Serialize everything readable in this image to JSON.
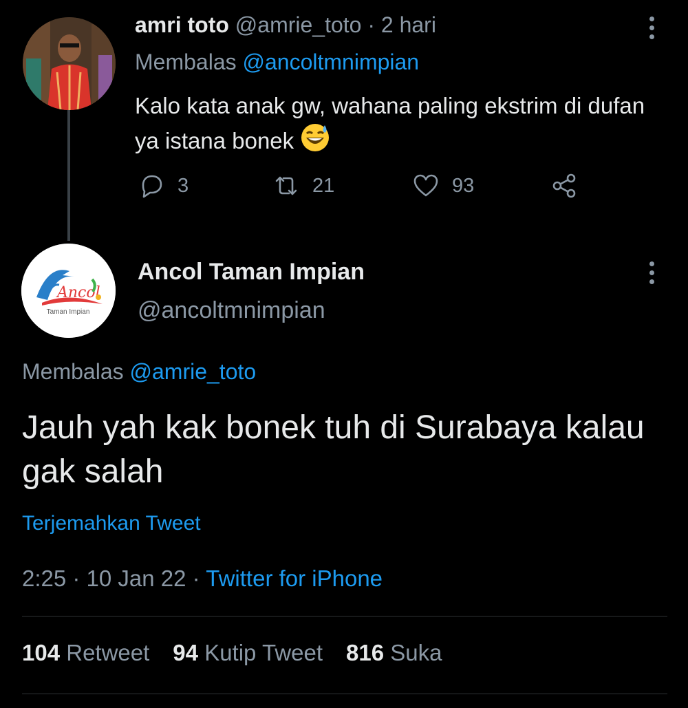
{
  "parent_tweet": {
    "name": "amri toto",
    "handle": "@amrie_toto",
    "time": "· 2 hari",
    "reply_prefix": "Membalas",
    "reply_to": "@ancoltmnimpian",
    "text": "Kalo kata anak gw, wahana paling ekstrim di dufan ya istana bonek",
    "emoji": "grinning-sweat-emoji",
    "replies": "3",
    "retweets": "21",
    "likes": "93"
  },
  "main_tweet": {
    "name": "Ancol Taman Impian",
    "handle": "@ancoltmnimpian",
    "logo_text": "Ancol",
    "logo_sub": "Taman Impian",
    "reply_prefix": "Membalas",
    "reply_to": "@amrie_toto",
    "text": "Jauh yah kak bonek tuh di Surabaya kalau gak salah",
    "translate": "Terjemahkan Tweet",
    "time": "2:25 · 10 Jan 22 ·",
    "source": "Twitter for iPhone",
    "retweet_count": "104",
    "retweet_label": "Retweet",
    "quote_count": "94",
    "quote_label": "Kutip Tweet",
    "like_count": "816",
    "like_label": "Suka"
  },
  "colors": {
    "background": "#000000",
    "text": "#e7e9ea",
    "muted": "#8b98a5",
    "link": "#1d9bf0"
  }
}
